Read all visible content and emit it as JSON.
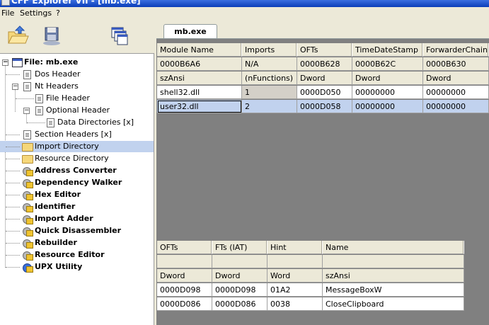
{
  "window": {
    "title": "CFF Explorer VII - [mb.exe]"
  },
  "menu": [
    "File",
    "Settings",
    "?"
  ],
  "toolbar": [
    "open-icon",
    "save-icon",
    "windows-icon"
  ],
  "tree": {
    "root": "File: mb.exe",
    "items": [
      "Dos Header",
      "Nt Headers",
      "File Header",
      "Optional Header",
      "Data Directories [x]",
      "Section Headers [x]",
      "Import Directory",
      "Resource Directory",
      "Address Converter",
      "Dependency Walker",
      "Hex Editor",
      "Identifier",
      "Import Adder",
      "Quick Disassembler",
      "Rebuilder",
      "Resource Editor",
      "UPX Utility"
    ],
    "selected": "Import Directory"
  },
  "tab": {
    "label": "mb.exe"
  },
  "modules": {
    "headers": [
      "Module Name",
      "Imports",
      "OFTs",
      "TimeDateStamp",
      "ForwarderChain"
    ],
    "offsets": [
      "0000B6A6",
      "N/A",
      "0000B628",
      "0000B62C",
      "0000B630"
    ],
    "types": [
      "szAnsi",
      "(nFunctions)",
      "Dword",
      "Dword",
      "Dword"
    ],
    "rows": [
      [
        "shell32.dll",
        "1",
        "0000D050",
        "00000000",
        "00000000"
      ],
      [
        "user32.dll",
        "2",
        "0000D058",
        "00000000",
        "00000000"
      ]
    ],
    "selected_row": "user32.dll"
  },
  "functions": {
    "headers": [
      "OFTs",
      "FTs (IAT)",
      "Hint",
      "Name"
    ],
    "offsets": [
      "",
      "",
      "",
      ""
    ],
    "types": [
      "Dword",
      "Dword",
      "Word",
      "szAnsi"
    ],
    "rows": [
      [
        "0000D098",
        "0000D098",
        "01A2",
        "MessageBoxW"
      ],
      [
        "0000D086",
        "0000D086",
        "0038",
        "CloseClipboard"
      ]
    ]
  },
  "colors": {
    "selection": "#c1d2ee",
    "title_bar": "#0a3db8",
    "panel": "#808080"
  }
}
